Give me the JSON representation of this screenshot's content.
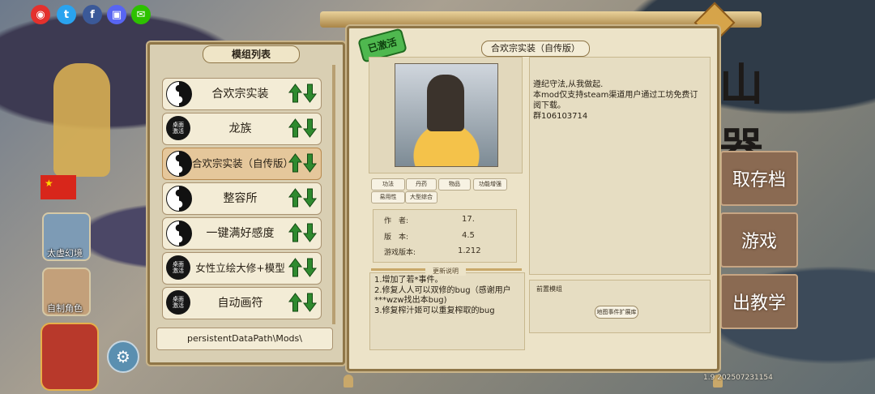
{
  "social": {
    "icons": [
      "weibo-icon",
      "twitter-icon",
      "facebook-icon",
      "discord-icon",
      "wechat-icon"
    ],
    "glyphs": [
      "◉",
      "t",
      "f",
      "▣",
      "✉"
    ]
  },
  "side": {
    "items": [
      {
        "label": "太虚幻境"
      },
      {
        "label": "自制角色"
      }
    ]
  },
  "mod_list": {
    "title": "模组列表",
    "items": [
      {
        "name": "合欢宗实装",
        "icon": "taiji",
        "selected": false
      },
      {
        "name": "龙族",
        "icon": "badge",
        "badge_text": "桌面\n激活",
        "selected": false
      },
      {
        "name": "合欢宗实装（自传版）",
        "icon": "taiji",
        "selected": true
      },
      {
        "name": "整容所",
        "icon": "taiji",
        "selected": false
      },
      {
        "name": "一键满好感度",
        "icon": "taiji",
        "selected": false
      },
      {
        "name": "女性立绘大修+模型",
        "icon": "badge",
        "badge_text": "桌面\n激活",
        "selected": false
      },
      {
        "name": "自动画符",
        "icon": "badge",
        "badge_text": "桌面\n激活",
        "selected": false
      }
    ],
    "path": "persistentDataPath\\Mods\\"
  },
  "detail": {
    "title": "合欢宗实装（自传版）",
    "status": "已激活",
    "tags": [
      "功法",
      "丹药",
      "物品",
      "功能增强",
      "易用性",
      "大型综合"
    ],
    "author_label": "作　者:",
    "author": "17.",
    "version_label": "版　本:",
    "version": "4.5",
    "game_version_label": "游戏版本:",
    "game_version": "1.212",
    "description": "遵纪守法,从我做起.\n本mod仅支持steam渠道用户通过工坊免费订阅下载。\n群106103714",
    "changelog_title": "更新说明",
    "changelog": "1.增加了若*事件。\n2.修复人人可以双修的bug（感谢用户***wzw找出本bug)\n3.修复榨汁姬可以重复榨取的bug",
    "prereq_label": "前置模组",
    "prereq": "地图事件扩展库"
  },
  "menu": {
    "items": [
      "取存档",
      "游戏",
      "出教学"
    ]
  },
  "build": "1.9 202507231154",
  "colors": {
    "selected": "#e5c79b",
    "arrow_up": "#2f8a2f",
    "arrow_down": "#2f8a2f",
    "enabled": "#4fb84f"
  }
}
